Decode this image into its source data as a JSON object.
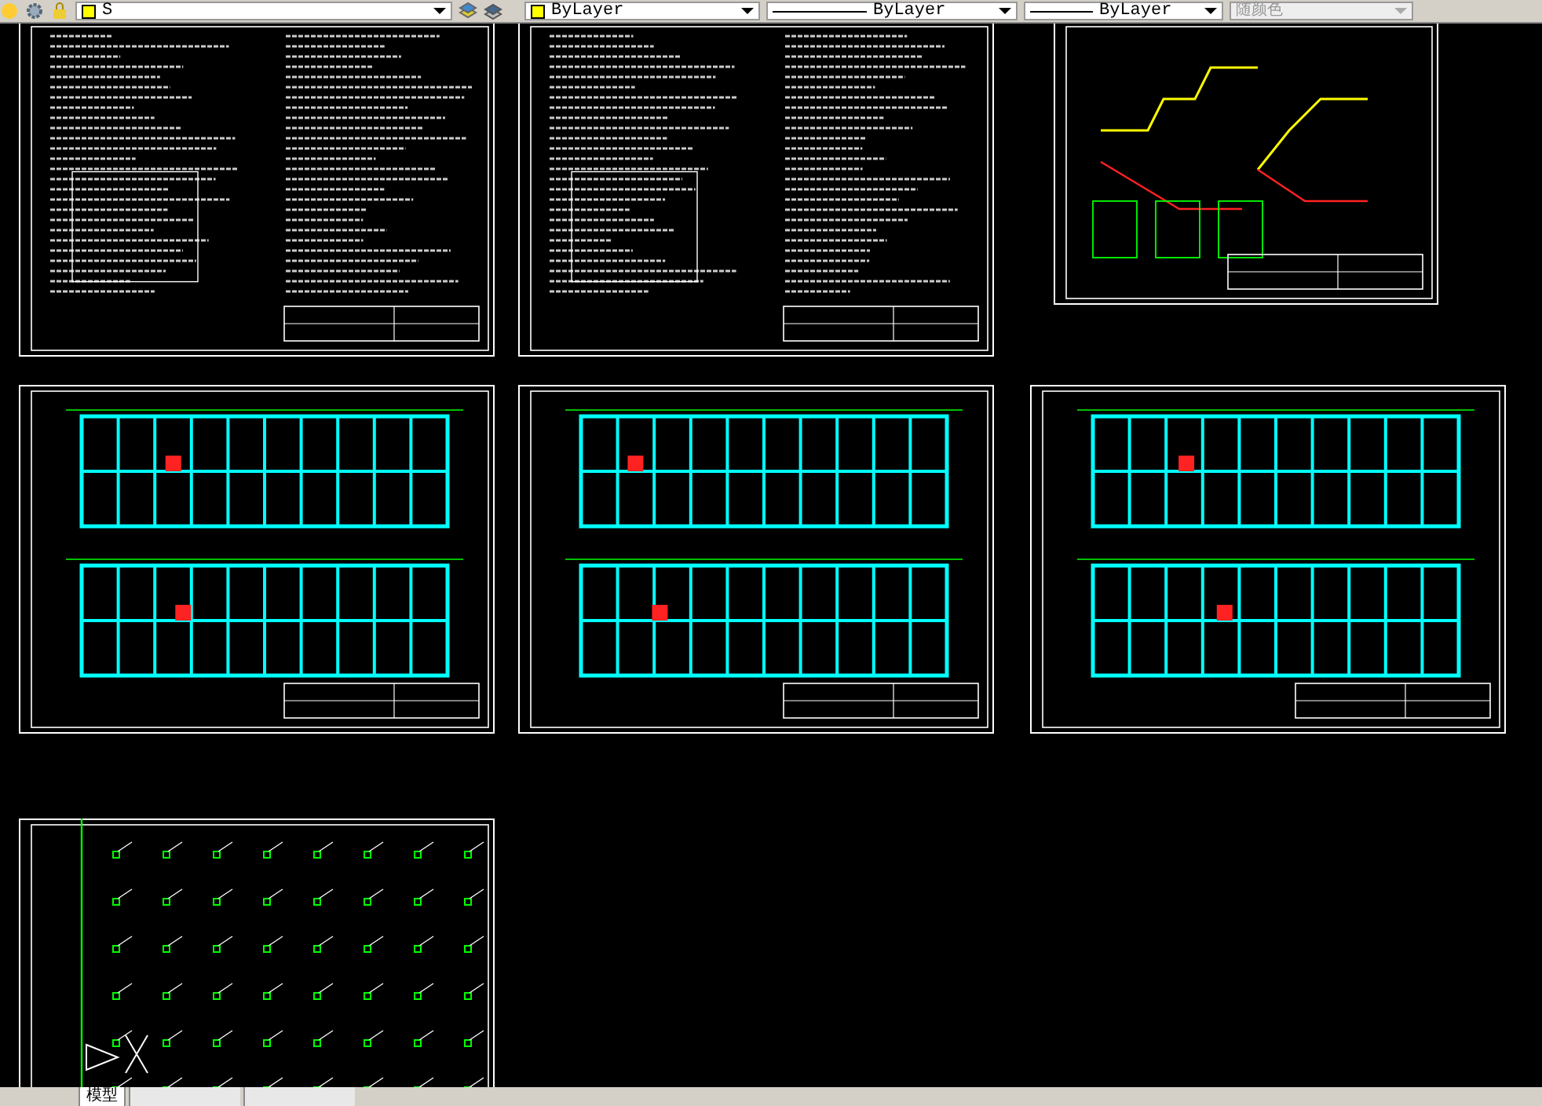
{
  "toolbar": {
    "layer": {
      "value": "S"
    },
    "color": {
      "value": "ByLayer"
    },
    "linetype": {
      "value": "ByLayer"
    },
    "lineweight": {
      "value": "ByLayer"
    },
    "plot_style": {
      "value": "随颜色",
      "disabled": true
    }
  },
  "sheets": [
    {
      "kind": "notes"
    },
    {
      "kind": "notes"
    },
    {
      "kind": "details"
    },
    {
      "kind": "plan"
    },
    {
      "kind": "plan"
    },
    {
      "kind": "plan"
    },
    {
      "kind": "points"
    }
  ],
  "layout_tabs": [
    {
      "label": "模型",
      "selected": true
    }
  ]
}
